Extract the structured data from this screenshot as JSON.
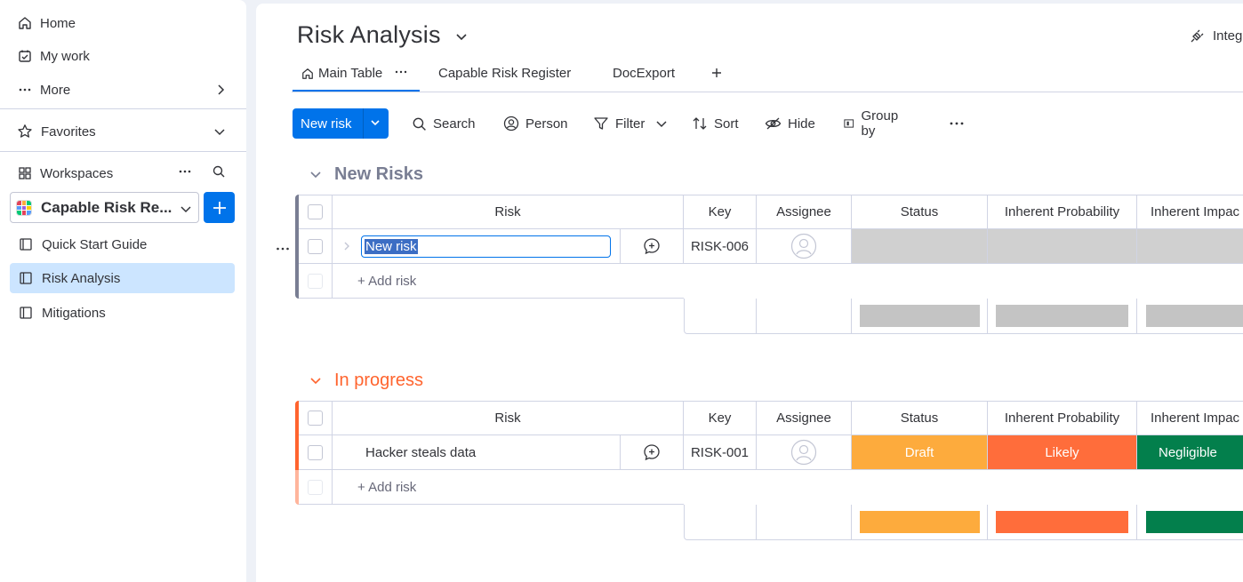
{
  "sidebar": {
    "home": "Home",
    "my_work": "My work",
    "more": "More",
    "favorites": "Favorites",
    "workspaces": "Workspaces",
    "workspace_name": "Capable Risk Re...",
    "boards": [
      {
        "label": "Quick Start Guide",
        "icon": "book-icon"
      },
      {
        "label": "Risk Analysis",
        "icon": "board-icon",
        "active": true
      },
      {
        "label": "Mitigations",
        "icon": "board-icon"
      }
    ]
  },
  "header": {
    "title": "Risk Analysis",
    "integrate": "Integ"
  },
  "tabs": [
    "Main Table",
    "Capable Risk Register",
    "DocExport"
  ],
  "toolbar": {
    "new_item": "New risk",
    "search": "Search",
    "person": "Person",
    "filter": "Filter",
    "sort": "Sort",
    "hide": "Hide",
    "group_by": "Group by"
  },
  "columns": [
    "Risk",
    "Key",
    "Assignee",
    "Status",
    "Inherent Probability",
    "Inherent Impac"
  ],
  "groups": [
    {
      "name": "New Risks",
      "color": "#797e93",
      "rows": [
        {
          "risk": "New risk",
          "key": "RISK-006",
          "status": "",
          "probability": "",
          "impact": ""
        }
      ],
      "add_label": "+ Add risk"
    },
    {
      "name": "In progress",
      "color": "#ff642e",
      "rows": [
        {
          "risk": "Hacker steals data",
          "key": "RISK-001",
          "status": "Draft",
          "probability": "Likely",
          "impact": "Negligible"
        }
      ],
      "add_label": "+ Add risk"
    }
  ],
  "colors": {
    "primary": "#0073ea",
    "draft": "#fdab3d",
    "likely": "#ff6d3b",
    "negligible": "#037f4c",
    "empty": "#c4c4c4"
  }
}
